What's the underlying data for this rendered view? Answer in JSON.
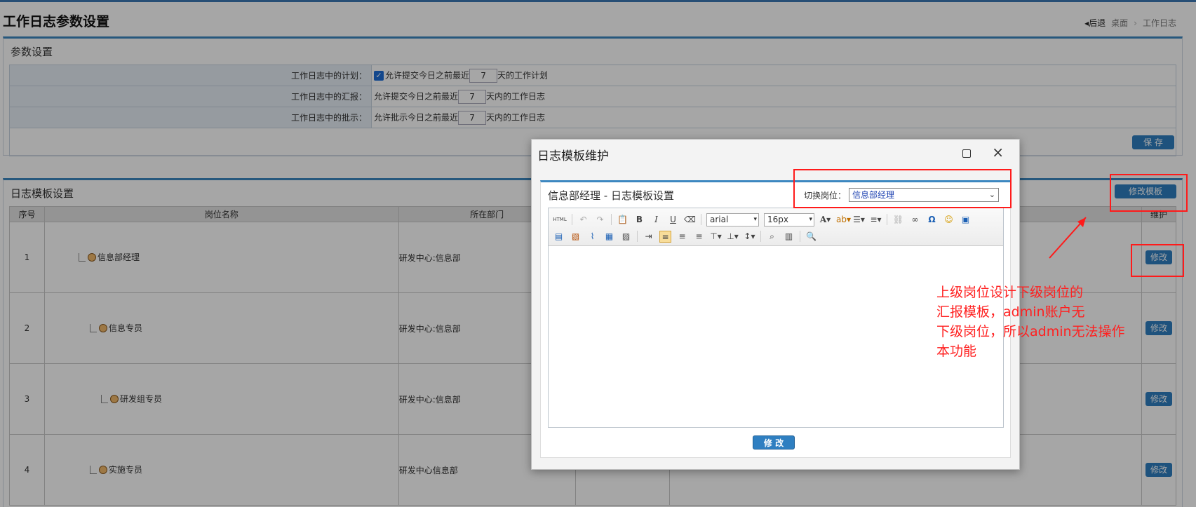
{
  "page": {
    "title": "工作日志参数设置",
    "breadcrumb": {
      "back": "后退",
      "home": "桌面",
      "current": "工作日志"
    }
  },
  "params_panel": {
    "title": "参数设置",
    "rows": [
      {
        "label": "工作日志中的计划：",
        "prefix": "允许提交今日之前最近",
        "value": "7",
        "suffix": "天的工作计划",
        "checked": true
      },
      {
        "label": "工作日志中的汇报：",
        "prefix": "允许提交今日之前最近",
        "value": "7",
        "suffix": "天内的工作日志",
        "checked": false
      },
      {
        "label": "工作日志中的批示：",
        "prefix": "允许批示今日之前最近",
        "value": "7",
        "suffix": "天内的工作日志",
        "checked": false
      }
    ],
    "save_label": "保 存"
  },
  "template_panel": {
    "title": "日志模板设置",
    "modify_template_label": "修改模板",
    "columns": [
      "序号",
      "岗位名称",
      "所在部门",
      "维护"
    ],
    "rows": [
      {
        "index": "1",
        "name": "信息部经理",
        "dept": "研发中心:信息部",
        "action": "修改"
      },
      {
        "index": "2",
        "name": "信息专员",
        "dept": "研发中心:信息部",
        "action": "修改"
      },
      {
        "index": "3",
        "name": "研发组专员",
        "dept": "研发中心:信息部",
        "action": "修改"
      },
      {
        "index": "4",
        "name": "实施专员",
        "dept": "研发中心信息部",
        "action": "修改"
      }
    ]
  },
  "dialog": {
    "title": "日志模板维护",
    "inner_title": "信息部经理 - 日志模板设置",
    "switch_label": "切换岗位：",
    "switch_value": "信息部经理",
    "font_family": "arial",
    "font_size": "16px",
    "html_label": "HTML",
    "submit_label": "修 改"
  },
  "annotation": {
    "note_lines": [
      "上级岗位设计下级岗位的",
      "汇报模板，admin账户无",
      "下级岗位，所以admin无法操作",
      "本功能"
    ],
    "color": "#ff2020"
  }
}
